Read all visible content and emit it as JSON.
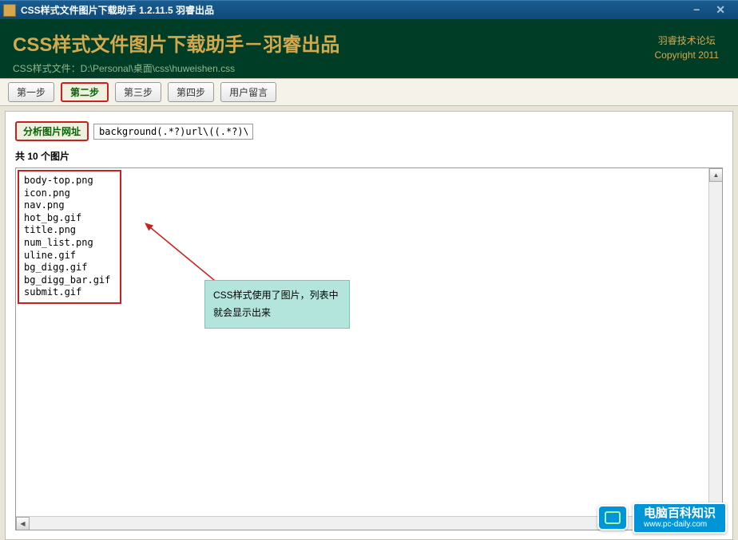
{
  "titlebar": {
    "text": "CSS样式文件图片下载助手  1.2.11.5   羽睿出品"
  },
  "header": {
    "title": "CSS样式文件图片下载助手－羽睿出品",
    "subtitle": "CSS样式文件：D:\\Personal\\桌面\\css\\huweishen.css",
    "right_line1": "羽睿技术论坛",
    "right_line2": "Copyright 2011"
  },
  "tabs": [
    {
      "label": "第一步"
    },
    {
      "label": "第二步"
    },
    {
      "label": "第三步"
    },
    {
      "label": "第四步"
    },
    {
      "label": "用户留言"
    }
  ],
  "action": {
    "analyze_label": "分析图片网址",
    "pattern_value": "background(.*?)url\\((.*?)\\)"
  },
  "count_label": "共 10 个图片",
  "files": [
    "body-top.png",
    "icon.png",
    "nav.png",
    "hot_bg.gif",
    "title.png",
    "num_list.png",
    "uline.gif",
    "bg_digg.gif",
    "bg_digg_bar.gif",
    "submit.gif"
  ],
  "annotation": "CSS样式使用了图片，列表中就会显示出来",
  "watermark": {
    "name": "电脑百科知识",
    "url": "www.pc-daily.com"
  }
}
